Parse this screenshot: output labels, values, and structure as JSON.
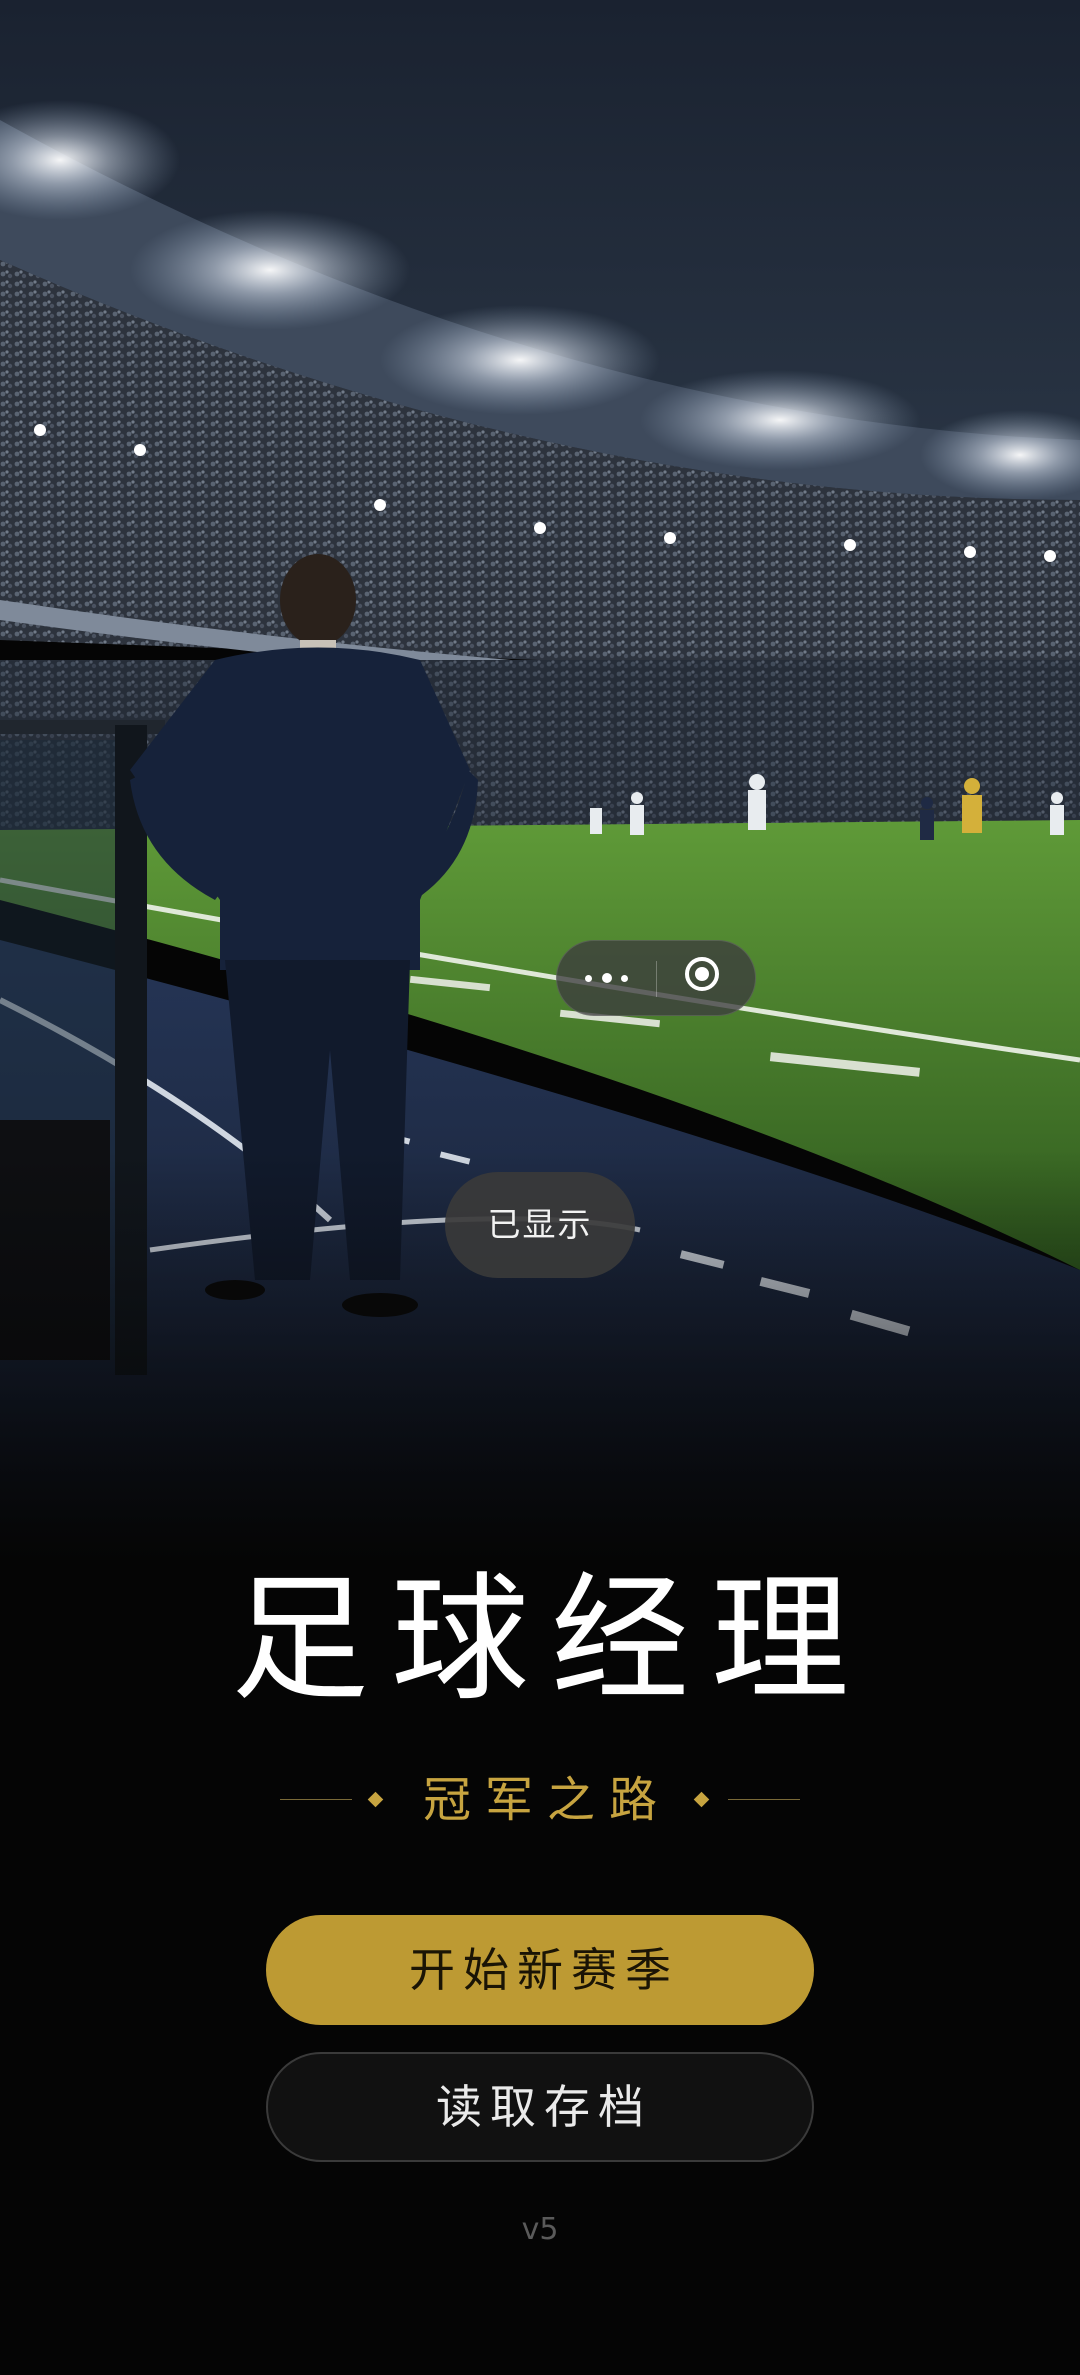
{
  "app": {
    "title": "足球经理",
    "subtitle": "冠军之路",
    "version": "v5"
  },
  "buttons": {
    "new_season": "开始新赛季",
    "load_save": "读取存档"
  },
  "toast": {
    "text": "已显示"
  },
  "capsule": {
    "more_icon": "more-dots-icon",
    "close_icon": "close-target-icon"
  },
  "colors": {
    "accent_gold": "#bd9a33",
    "subtitle_gold": "#c7a440",
    "background": "#050505"
  }
}
